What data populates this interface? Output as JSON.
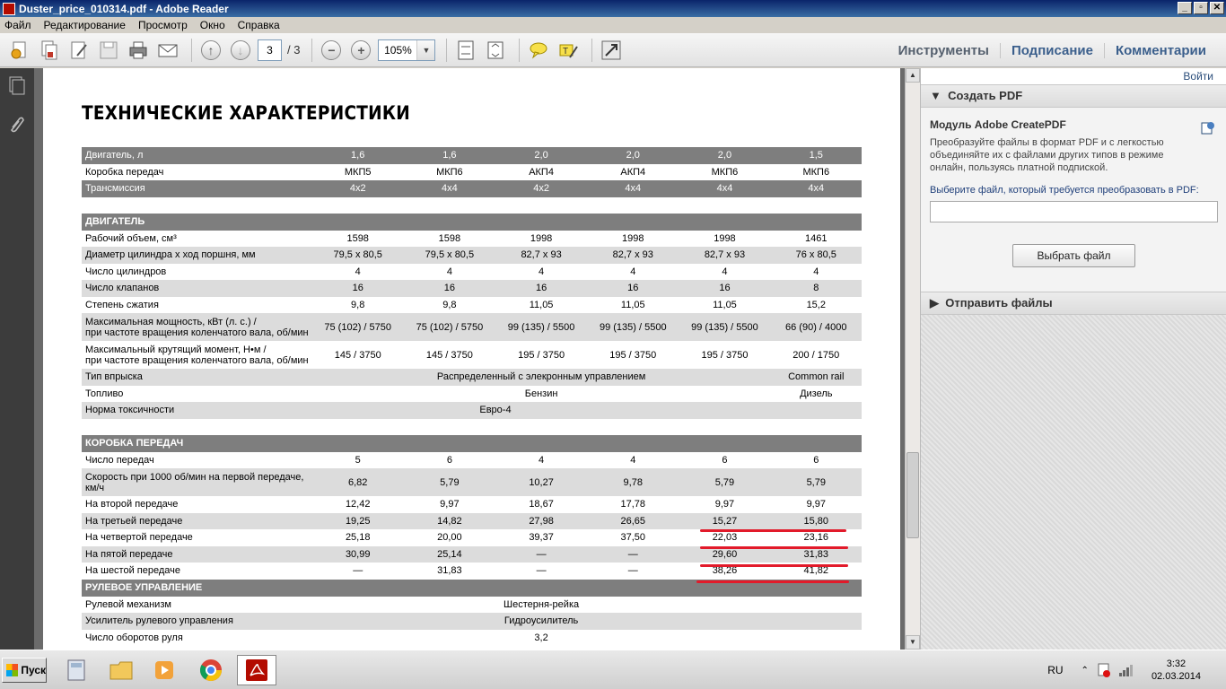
{
  "window": {
    "title": "Duster_price_010314.pdf - Adobe Reader"
  },
  "menu": [
    "Файл",
    "Редактирование",
    "Просмотр",
    "Окно",
    "Справка"
  ],
  "toolbar": {
    "page_current": "3",
    "page_total": "/  3",
    "zoom": "105%"
  },
  "tabs": [
    "Инструменты",
    "Подписание",
    "Комментарии"
  ],
  "doc": {
    "title": "ТЕХНИЧЕСКИЕ ХАРАКТЕРИСТИКИ",
    "header_rows": [
      {
        "style": "dk",
        "label": "Двигатель, л",
        "cells": [
          "1,6",
          "1,6",
          "2,0",
          "2,0",
          "2,0",
          "1,5"
        ]
      },
      {
        "style": "w",
        "label": "Коробка передач",
        "cells": [
          "МКП5",
          "МКП6",
          "АКП4",
          "АКП4",
          "МКП6",
          "МКП6"
        ]
      },
      {
        "style": "dk",
        "label": "Трансмиссия",
        "cells": [
          "4x2",
          "4x4",
          "4x2",
          "4x4",
          "4x4",
          "4x4"
        ]
      }
    ],
    "engine_section": "ДВИГАТЕЛЬ",
    "engine_rows": [
      {
        "style": "w",
        "label": "Рабочий объем, см³",
        "cells": [
          "1598",
          "1598",
          "1998",
          "1998",
          "1998",
          "1461"
        ]
      },
      {
        "style": "g",
        "label": "Диаметр цилиндра х ход поршня, мм",
        "cells": [
          "79,5 x 80,5",
          "79,5 x 80,5",
          "82,7 x 93",
          "82,7 x 93",
          "82,7 x 93",
          "76 x 80,5"
        ]
      },
      {
        "style": "w",
        "label": "Число цилиндров",
        "cells": [
          "4",
          "4",
          "4",
          "4",
          "4",
          "4"
        ]
      },
      {
        "style": "g",
        "label": "Число клапанов",
        "cells": [
          "16",
          "16",
          "16",
          "16",
          "16",
          "8"
        ]
      },
      {
        "style": "w",
        "label": "Степень сжатия",
        "cells": [
          "9,8",
          "9,8",
          "11,05",
          "11,05",
          "11,05",
          "15,2"
        ]
      },
      {
        "style": "g",
        "label": "Максимальная мощность, кВт (л. с.) /",
        "label2": "при частоте вращения коленчатого вала, об/мин",
        "cells": [
          "75 (102) / 5750",
          "75 (102) / 5750",
          "99 (135) / 5500",
          "99 (135) / 5500",
          "99 (135) / 5500",
          "66 (90) / 4000"
        ]
      },
      {
        "style": "w",
        "label": "Максимальный крутящий момент, Н•м /",
        "label2": "при частоте вращения коленчатого вала, об/мин",
        "cells": [
          "145 / 3750",
          "145 / 3750",
          "195 / 3750",
          "195 / 3750",
          "195 / 3750",
          "200 / 1750"
        ]
      }
    ],
    "injection": {
      "label": "Тип впрыска",
      "petrol": "Распределенный с элекронным управлением",
      "diesel": "Common rail"
    },
    "fuel": {
      "label": "Топливо",
      "petrol": "Бензин",
      "diesel": "Дизель"
    },
    "emission": {
      "label": "Норма токсичности",
      "value": "Евро-4"
    },
    "gearbox_section": "КОРОБКА ПЕРЕДАЧ",
    "gearbox_rows": [
      {
        "style": "w",
        "label": "Число передач",
        "cells": [
          "5",
          "6",
          "4",
          "4",
          "6",
          "6"
        ]
      },
      {
        "style": "g",
        "label": "Скорость при 1000 об/мин на первой передаче,",
        "label2": "км/ч",
        "cells": [
          "6,82",
          "5,79",
          "10,27",
          "9,78",
          "5,79",
          "5,79"
        ]
      },
      {
        "style": "w",
        "label": "На второй передаче",
        "cells": [
          "12,42",
          "9,97",
          "18,67",
          "17,78",
          "9,97",
          "9,97"
        ]
      },
      {
        "style": "g",
        "label": "На третьей передаче",
        "cells": [
          "19,25",
          "14,82",
          "27,98",
          "26,65",
          "15,27",
          "15,80"
        ]
      },
      {
        "style": "w",
        "label": "На четвертой передаче",
        "cells": [
          "25,18",
          "20,00",
          "39,37",
          "37,50",
          "22,03",
          "23,16"
        ]
      },
      {
        "style": "g",
        "label": "На пятой передаче",
        "cells": [
          "30,99",
          "25,14",
          "—",
          "—",
          "29,60",
          "31,83"
        ]
      },
      {
        "style": "w",
        "label": "На шестой передаче",
        "cells": [
          "—",
          "31,83",
          "—",
          "—",
          "38,26",
          "41,82"
        ]
      }
    ],
    "steering_section": "РУЛЕВОЕ УПРАВЛЕНИЕ",
    "steering_rows": [
      {
        "style": "w",
        "label": "Рулевой механизм",
        "value": "Шестерня-рейка"
      },
      {
        "style": "g",
        "label": "Усилитель рулевого управления",
        "value": "Гидроусилитель"
      },
      {
        "style": "w",
        "label": "Число оборотов руля",
        "value": "3,2"
      }
    ]
  },
  "panel": {
    "login": "Войти",
    "create_pdf_header": "Создать PDF",
    "module_title": "Модуль Adobe CreatePDF",
    "module_desc": "Преобразуйте файлы в формат PDF и с легкостью объединяйте их с файлами других типов в режиме онлайн, пользуясь платной подпиской.",
    "prompt": "Выберите файл, который требуется преобразовать в PDF:",
    "choose_button": "Выбрать файл",
    "send_files_header": "Отправить файлы"
  },
  "taskbar": {
    "start": "Пуск",
    "lang": "RU",
    "time": "3:32",
    "date": "02.03.2014"
  },
  "colors": {
    "accent_red": "#e21a2a",
    "header_gray": "#7e7e7e"
  }
}
